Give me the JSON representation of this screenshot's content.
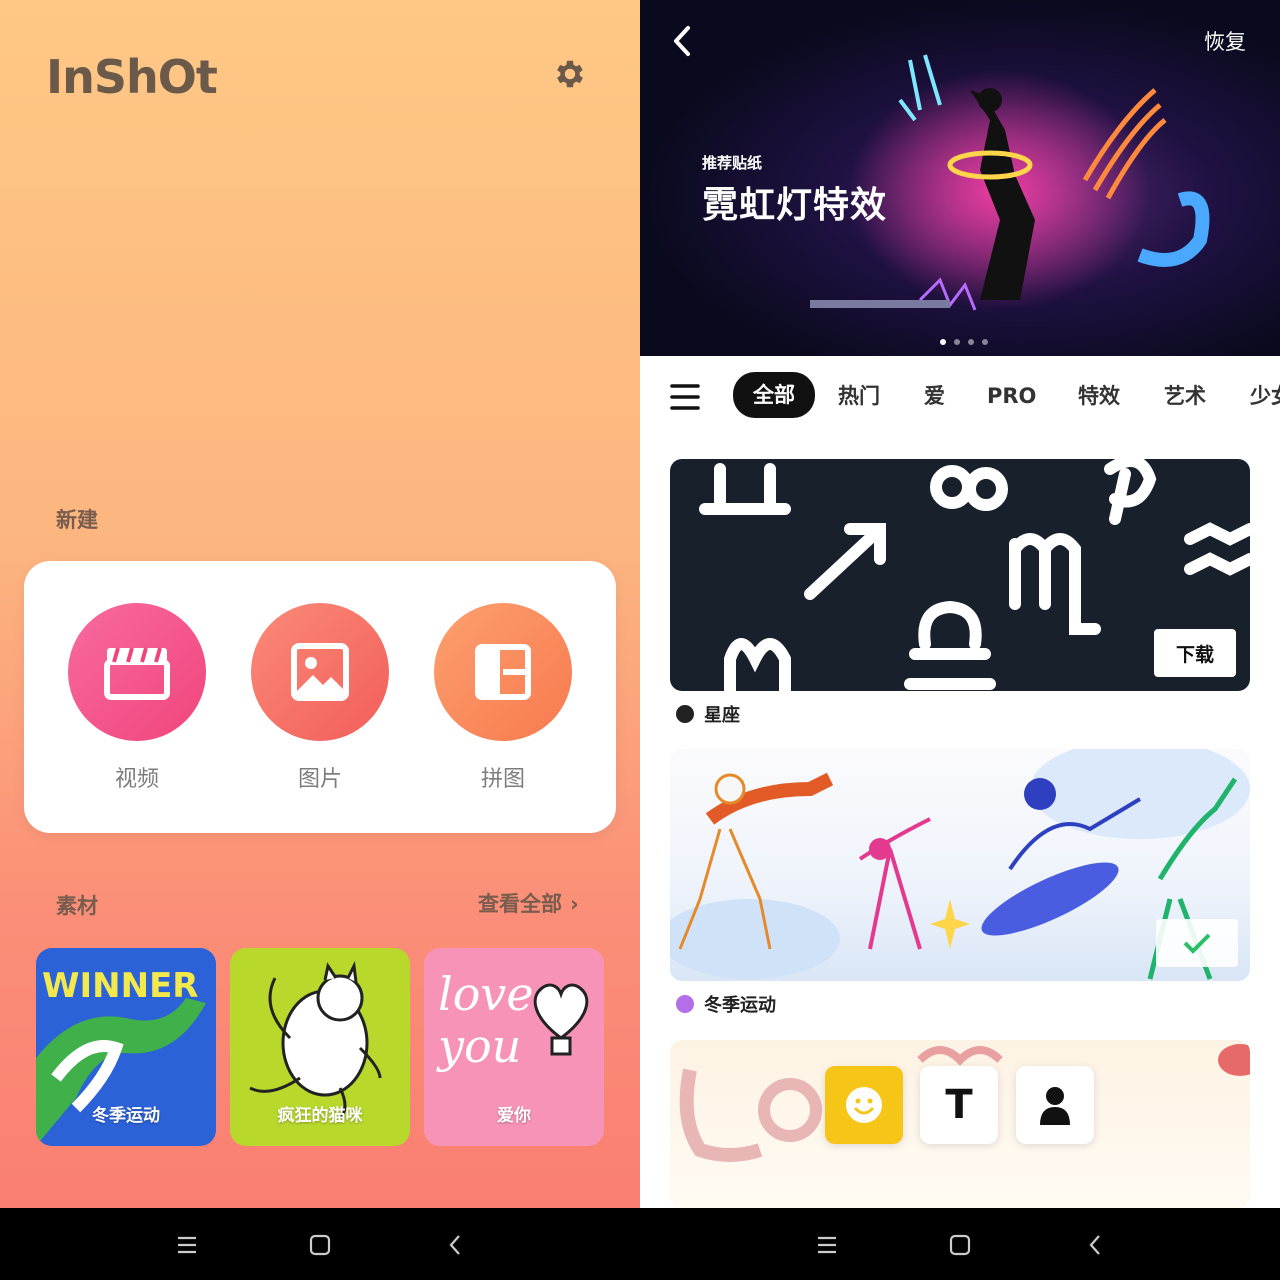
{
  "left": {
    "logo": "InShOt",
    "section_new": "新建",
    "new_buttons": [
      {
        "label": "视频",
        "icon": "clapperboard-icon",
        "color_from": "#f86aa0",
        "color_to": "#f0457c"
      },
      {
        "label": "图片",
        "icon": "image-icon",
        "color_from": "#fb8a78",
        "color_to": "#f25e5a"
      },
      {
        "label": "拼图",
        "icon": "collage-icon",
        "color_from": "#fda06e",
        "color_to": "#f7794f"
      }
    ],
    "section_material": "素材",
    "see_all": "查看全部",
    "thumbnails": [
      {
        "label": "冬季运动",
        "text": "WINNER",
        "bg": "#2c62d8"
      },
      {
        "label": "疯狂的猫咪",
        "bg": "#b8d82c"
      },
      {
        "label": "爱你",
        "text": "love you",
        "bg": "#f893b8"
      }
    ]
  },
  "right": {
    "restore": "恢复",
    "banner_small": "推荐贴纸",
    "banner_title": "霓虹灯特效",
    "tabs": [
      "全部",
      "热门",
      "爱",
      "PRO",
      "特效",
      "艺术",
      "少女"
    ],
    "packs": [
      {
        "name": "星座",
        "action": "下载",
        "smiley_color": "#222"
      },
      {
        "name": "冬季运动",
        "smiley_color": "#b46ee8"
      }
    ],
    "fabs": [
      {
        "icon": "smiley-icon",
        "bg": "#f5c518"
      },
      {
        "icon": "text-icon",
        "glyph": "T",
        "bg": "#ffffff"
      },
      {
        "icon": "person-icon",
        "bg": "#ffffff"
      }
    ]
  },
  "navbar": {
    "items": [
      "menu-icon",
      "home-square-icon",
      "back-chevron-icon"
    ]
  }
}
